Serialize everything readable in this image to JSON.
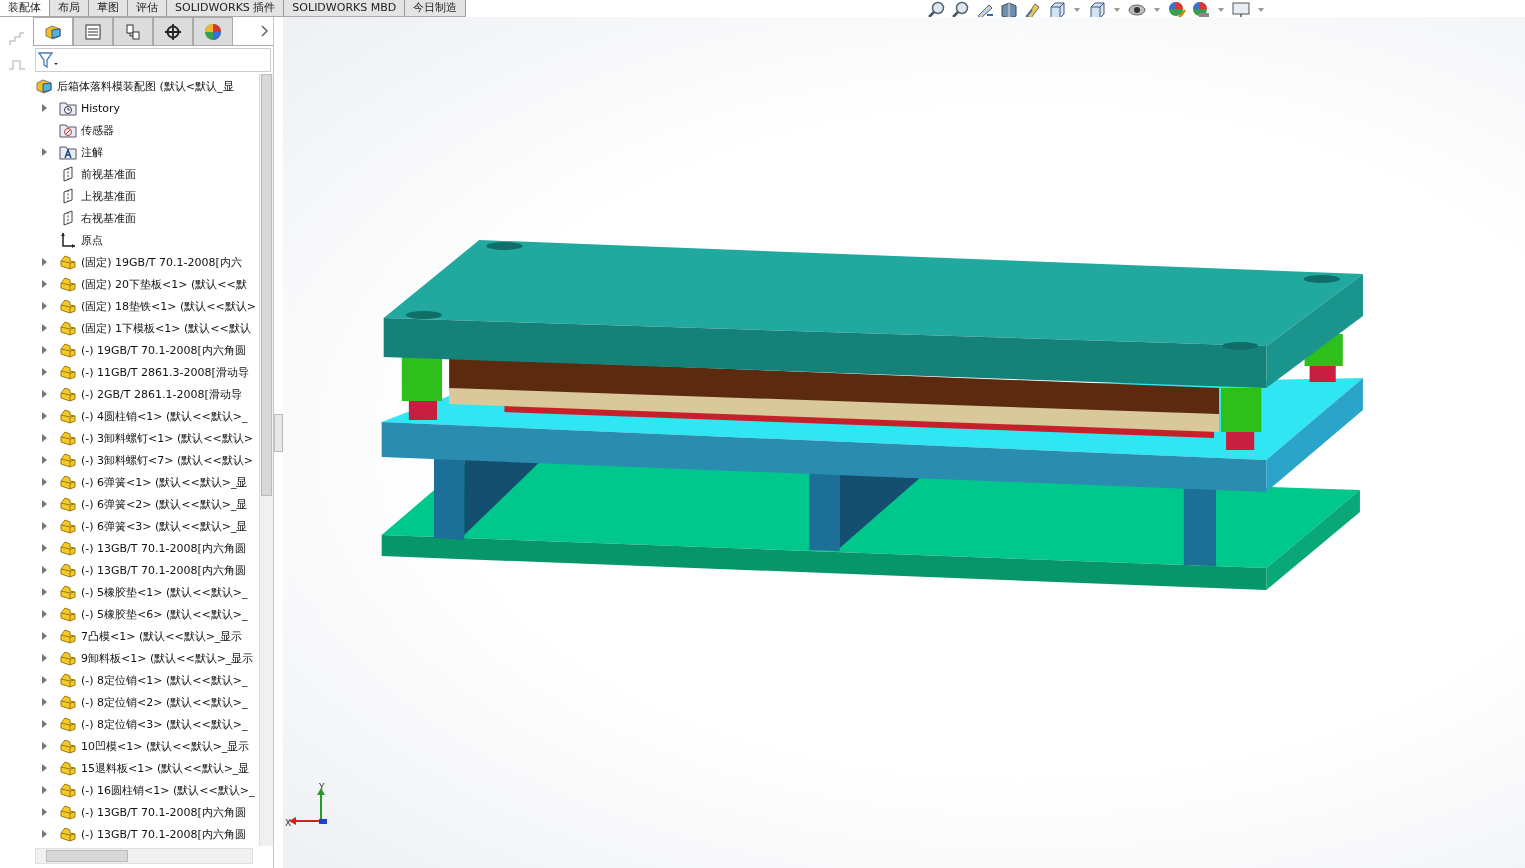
{
  "command_tabs": [
    {
      "label": "装配体",
      "selected": true
    },
    {
      "label": "布局",
      "selected": false
    },
    {
      "label": "草图",
      "selected": false
    },
    {
      "label": "评估",
      "selected": false
    },
    {
      "label": "SOLIDWORKS 插件",
      "selected": false
    },
    {
      "label": "SOLIDWORKS MBD",
      "selected": false
    },
    {
      "label": "今日制造",
      "selected": false
    }
  ],
  "panel_tabs": [
    {
      "kind": "tree",
      "selected": true
    },
    {
      "kind": "property",
      "selected": false
    },
    {
      "kind": "config",
      "selected": false
    },
    {
      "kind": "dim",
      "selected": false
    },
    {
      "kind": "display",
      "selected": false
    }
  ],
  "tree": {
    "label": "后箱体落料模装配图 (默认<默认_显",
    "kind": "assembly",
    "children": [
      {
        "label": "History",
        "kind": "history",
        "expandable": true
      },
      {
        "label": "传感器",
        "kind": "sensor",
        "expandable": false
      },
      {
        "label": "注解",
        "kind": "annotation",
        "expandable": true
      },
      {
        "label": "前视基准面",
        "kind": "plane",
        "expandable": false
      },
      {
        "label": "上视基准面",
        "kind": "plane",
        "expandable": false
      },
      {
        "label": "右视基准面",
        "kind": "plane",
        "expandable": false
      },
      {
        "label": "原点",
        "kind": "origin",
        "expandable": false
      },
      {
        "label": "(固定) 19GB/T 70.1-2008[内六",
        "kind": "part",
        "expandable": true
      },
      {
        "label": "(固定) 20下垫板<1> (默认<<默",
        "kind": "part",
        "expandable": true
      },
      {
        "label": "(固定) 18垫铁<1> (默认<<默认>",
        "kind": "part",
        "expandable": true
      },
      {
        "label": "(固定) 1下模板<1> (默认<<默认",
        "kind": "part",
        "expandable": true
      },
      {
        "label": "(-) 19GB/T 70.1-2008[内六角圆",
        "kind": "part",
        "expandable": true
      },
      {
        "label": "(-) 11GB/T 2861.3-2008[滑动导",
        "kind": "part",
        "expandable": true
      },
      {
        "label": "(-) 2GB/T 2861.1-2008[滑动导",
        "kind": "part",
        "expandable": true
      },
      {
        "label": "(-) 4圆柱销<1> (默认<<默认>_",
        "kind": "part",
        "expandable": true
      },
      {
        "label": "(-) 3卸料螺钉<1> (默认<<默认>",
        "kind": "part",
        "expandable": true
      },
      {
        "label": "(-) 3卸料螺钉<7> (默认<<默认>",
        "kind": "part",
        "expandable": true
      },
      {
        "label": "(-) 6弹簧<1> (默认<<默认>_显",
        "kind": "part",
        "expandable": true
      },
      {
        "label": "(-) 6弹簧<2> (默认<<默认>_显",
        "kind": "part",
        "expandable": true
      },
      {
        "label": "(-) 6弹簧<3> (默认<<默认>_显",
        "kind": "part",
        "expandable": true
      },
      {
        "label": "(-) 13GB/T 70.1-2008[内六角圆",
        "kind": "part",
        "expandable": true
      },
      {
        "label": "(-) 13GB/T 70.1-2008[内六角圆",
        "kind": "part",
        "expandable": true
      },
      {
        "label": "(-) 5橡胶垫<1> (默认<<默认>_",
        "kind": "part",
        "expandable": true
      },
      {
        "label": "(-) 5橡胶垫<6> (默认<<默认>_",
        "kind": "part",
        "expandable": true
      },
      {
        "label": "7凸模<1> (默认<<默认>_显示",
        "kind": "part",
        "expandable": true
      },
      {
        "label": "9卸料板<1> (默认<<默认>_显示",
        "kind": "part",
        "expandable": true
      },
      {
        "label": "(-) 8定位销<1> (默认<<默认>_",
        "kind": "part",
        "expandable": true
      },
      {
        "label": "(-) 8定位销<2> (默认<<默认>_",
        "kind": "part",
        "expandable": true
      },
      {
        "label": "(-) 8定位销<3> (默认<<默认>_",
        "kind": "part",
        "expandable": true
      },
      {
        "label": "10凹模<1> (默认<<默认>_显示",
        "kind": "part",
        "expandable": true
      },
      {
        "label": "15退料板<1> (默认<<默认>_显",
        "kind": "part",
        "expandable": true
      },
      {
        "label": "(-) 16圆柱销<1> (默认<<默认>_",
        "kind": "part",
        "expandable": true
      },
      {
        "label": "(-) 13GB/T 70.1-2008[内六角圆",
        "kind": "part",
        "expandable": true
      },
      {
        "label": "(-) 13GB/T 70.1-2008[内六角圆",
        "kind": "part",
        "expandable": true
      }
    ]
  },
  "triad": {
    "x": "X",
    "y": "Y"
  }
}
